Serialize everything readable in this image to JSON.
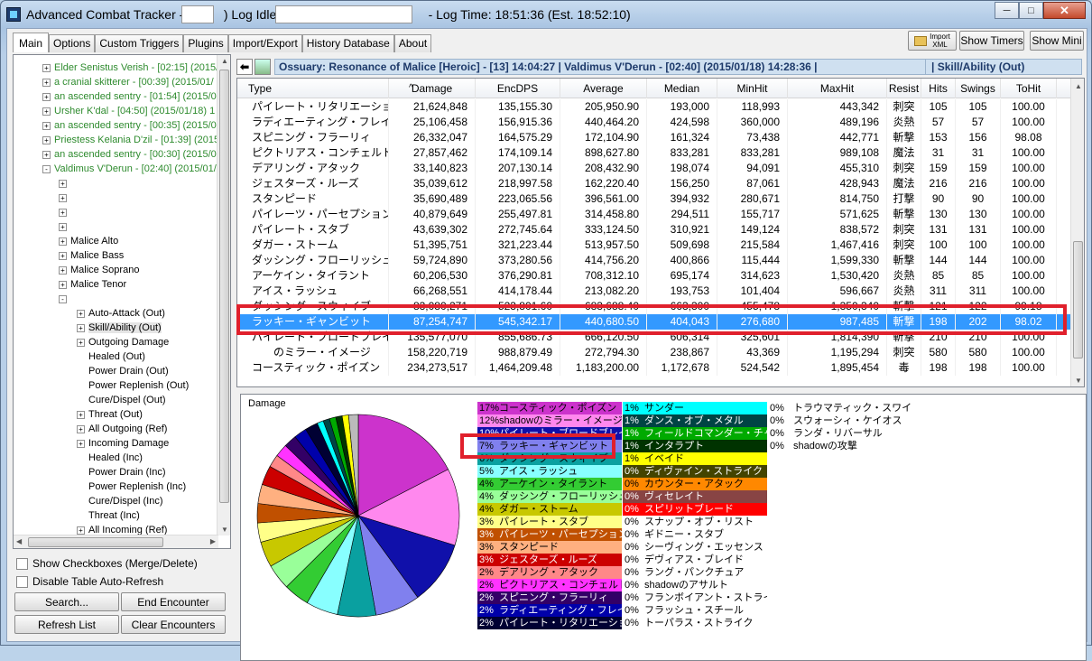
{
  "window": {
    "title_prefix": "Advanced Combat Tracker - (",
    "title_mid": ") Log Idle - ",
    "title_suffix": " - Log Time: 18:51:36 (Est. 18:52:10)",
    "minimize": "─",
    "maximize": "□",
    "close": "✕"
  },
  "tabs": [
    "Main",
    "Options",
    "Custom Triggers",
    "Plugins",
    "Import/Export",
    "History Database",
    "About"
  ],
  "toolbar": {
    "import_label_1": "Import",
    "import_label_2": "XML",
    "show_timers": "Show Timers",
    "show_mini": "Show Mini"
  },
  "tree": {
    "encounters": [
      "Elder Senistus Verish - [02:15] (2015/",
      "a cranial skitterer - [00:39] (2015/01/",
      "an ascended sentry - [01:54] (2015/0",
      "Ursher K'dal - [04:50] (2015/01/18) 1",
      "an ascended sentry - [00:35] (2015/0",
      "Priestess Kelania D'zil - [01:39] (2015/",
      "an ascended sentry - [00:30] (2015/0",
      "Valdimus V'Derun - [02:40] (2015/01/"
    ],
    "combatants": [
      "Malice Alto",
      "Malice Bass",
      "Malice Soprano",
      "Malice Tenor"
    ],
    "views": [
      "Auto-Attack (Out)",
      "Skill/Ability (Out)",
      "Outgoing Damage",
      "Healed (Out)",
      "Power Drain (Out)",
      "Power Replenish (Out)",
      "Cure/Dispel (Out)",
      "Threat (Out)",
      "All Outgoing (Ref)",
      "Incoming Damage",
      "Healed (Inc)",
      "Power Drain (Inc)",
      "Power Replenish (Inc)",
      "Cure/Dispel (Inc)",
      "Threat (Inc)",
      "All Incoming (Ref)"
    ]
  },
  "options": {
    "show_checkboxes": "Show Checkboxes (Merge/Delete)",
    "disable_refresh": "Disable Table Auto-Refresh"
  },
  "buttons": {
    "search": "Search...",
    "end_encounter": "End Encounter",
    "refresh_list": "Refresh List",
    "clear_encounters": "Clear Encounters"
  },
  "encounter_header": {
    "title": "Ossuary: Resonance of Malice [Heroic] - [13] 14:04:27  |  Valdimus V'Derun - [02:40] (2015/01/18) 14:28:36  |",
    "view": "|  Skill/Ability (Out)"
  },
  "table": {
    "columns": [
      "Type",
      "Damage",
      "EncDPS",
      "Average",
      "Median",
      "MinHit",
      "MaxHit",
      "Resist",
      "Hits",
      "Swings",
      "ToHit"
    ],
    "sort_indicator": "^",
    "rows": [
      [
        "パイレート・リタリエーション",
        "21,624,848",
        "135,155.30",
        "205,950.90",
        "193,000",
        "118,993",
        "443,342",
        "刺突",
        "105",
        "105",
        "100.00"
      ],
      [
        "ラディエーティング・フレイム III",
        "25,106,458",
        "156,915.36",
        "440,464.20",
        "424,598",
        "360,000",
        "489,196",
        "炎熱",
        "57",
        "57",
        "100.00"
      ],
      [
        "スピニング・フラーリィ",
        "26,332,047",
        "164,575.29",
        "172,104.90",
        "161,324",
        "73,438",
        "442,771",
        "斬撃",
        "153",
        "156",
        "98.08"
      ],
      [
        "ピクトリアス・コンチェルト",
        "27,857,462",
        "174,109.14",
        "898,627.80",
        "833,281",
        "833,281",
        "989,108",
        "魔法",
        "31",
        "31",
        "100.00"
      ],
      [
        "デアリング・アタック",
        "33,140,823",
        "207,130.14",
        "208,432.90",
        "198,074",
        "94,091",
        "455,310",
        "刺突",
        "159",
        "159",
        "100.00"
      ],
      [
        "ジェスターズ・ルーズ",
        "35,039,612",
        "218,997.58",
        "162,220.40",
        "156,250",
        "87,061",
        "428,943",
        "魔法",
        "216",
        "216",
        "100.00"
      ],
      [
        "スタンピード",
        "35,690,489",
        "223,065.56",
        "396,561.00",
        "394,932",
        "280,671",
        "814,750",
        "打撃",
        "90",
        "90",
        "100.00"
      ],
      [
        "パイレーツ・パーセプション",
        "40,879,649",
        "255,497.81",
        "314,458.80",
        "294,511",
        "155,717",
        "571,625",
        "斬撃",
        "130",
        "130",
        "100.00"
      ],
      [
        "パイレート・スタブ",
        "43,639,302",
        "272,745.64",
        "333,124.50",
        "310,921",
        "149,124",
        "838,572",
        "刺突",
        "131",
        "131",
        "100.00"
      ],
      [
        "ダガー・ストーム",
        "51,395,751",
        "321,223.44",
        "513,957.50",
        "509,698",
        "215,584",
        "1,467,416",
        "刺突",
        "100",
        "100",
        "100.00"
      ],
      [
        "ダッシング・フローリッシュ",
        "59,724,890",
        "373,280.56",
        "414,756.20",
        "400,866",
        "115,444",
        "1,599,330",
        "斬撃",
        "144",
        "144",
        "100.00"
      ],
      [
        "アーケイン・タイラント",
        "60,206,530",
        "376,290.81",
        "708,312.10",
        "695,174",
        "314,623",
        "1,530,420",
        "炎熱",
        "85",
        "85",
        "100.00"
      ],
      [
        "アイス・ラッシュ",
        "66,268,551",
        "414,178.44",
        "213,082.20",
        "193,753",
        "101,404",
        "596,667",
        "炎熱",
        "311",
        "311",
        "100.00"
      ],
      [
        "ダッシング・スウィイブ",
        "83,080,271",
        "523,801.60",
        "683,688.40",
        "663,300",
        "455,478",
        "1,350,340",
        "斬撃",
        "121",
        "122",
        "99.18"
      ],
      [
        "ラッキー・ギャンビット",
        "87,254,747",
        "545,342.17",
        "440,680.50",
        "404,043",
        "276,680",
        "987,485",
        "斬撃",
        "198",
        "202",
        "98.02"
      ],
      [
        "パイレート・ブロードブレイド",
        "135,577,070",
        "855,686.73",
        "666,120.50",
        "606,314",
        "325,601",
        "1,814,390",
        "斬撃",
        "210",
        "210",
        "100.00"
      ],
      [
        "　　のミラー・イメージ",
        "158,220,719",
        "988,879.49",
        "272,794.30",
        "238,867",
        "43,369",
        "1,195,294",
        "刺突",
        "580",
        "580",
        "100.00"
      ],
      [
        "コースティック・ポイズン",
        "234,273,517",
        "1,464,209.48",
        "1,183,200.00",
        "1,172,678",
        "524,542",
        "1,895,454",
        "毒",
        "198",
        "198",
        "100.00"
      ]
    ],
    "selected_index": 14
  },
  "chart_data": {
    "type": "pie",
    "title": "Damage",
    "slices": [
      {
        "label": "コースティック・ポイズン",
        "pct": 17,
        "color": "#cc33cc"
      },
      {
        "label": "shadowのミラー・イメージ",
        "pct": 12,
        "color": "#ff88ee"
      },
      {
        "label": "パイレート・ブロードブレイド",
        "pct": 10,
        "color": "#1010aa"
      },
      {
        "label": "ラッキー・ギャンビット",
        "pct": 7,
        "color": "#8080ee"
      },
      {
        "label": "ダッシング・スウィイブ",
        "pct": 6,
        "color": "#0aa0a0"
      },
      {
        "label": "アイス・ラッシュ",
        "pct": 5,
        "color": "#88ffff"
      },
      {
        "label": "アーケイン・タイラント",
        "pct": 4,
        "color": "#33cc33"
      },
      {
        "label": "ダッシング・フローリッシュ",
        "pct": 4,
        "color": "#99ff99"
      },
      {
        "label": "ダガー・ストーム",
        "pct": 4,
        "color": "#c8c800"
      },
      {
        "label": "パイレート・スタブ",
        "pct": 3,
        "color": "#ffff88"
      },
      {
        "label": "パイレーツ・パーセプション",
        "pct": 3,
        "color": "#c05000"
      },
      {
        "label": "スタンピード",
        "pct": 3,
        "color": "#ffb080"
      },
      {
        "label": "ジェスターズ・ルーズ",
        "pct": 3,
        "color": "#cc0000"
      },
      {
        "label": "デアリング・アタック",
        "pct": 2,
        "color": "#ff8888"
      },
      {
        "label": "ピクトリアス・コンチェルト",
        "pct": 2,
        "color": "#ff33ff"
      },
      {
        "label": "スピニング・フラーリィ",
        "pct": 2,
        "color": "#330066"
      },
      {
        "label": "ラディエーティング・フレイム III",
        "pct": 2,
        "color": "#0000aa"
      },
      {
        "label": "パイレート・リタリエーション",
        "pct": 2,
        "color": "#000033"
      },
      {
        "label": "サンダー",
        "pct": 1,
        "color": "#00ffff"
      },
      {
        "label": "ダンス・オブ・メタル",
        "pct": 1,
        "color": "#004444"
      },
      {
        "label": "フィールドコマンダー・チャージ",
        "pct": 1,
        "color": "#00aa00"
      },
      {
        "label": "インタラプト",
        "pct": 1,
        "color": "#003300"
      },
      {
        "label": "イベイド",
        "pct": 1,
        "color": "#ffff00"
      }
    ],
    "legend_col2": [
      {
        "pct": "1%",
        "label": "サンダー",
        "color": "#00ffff"
      },
      {
        "pct": "1%",
        "label": "ダンス・オブ・メタル",
        "color": "#004444"
      },
      {
        "pct": "1%",
        "label": "フィールドコマンダー・チャージ",
        "color": "#00aa00"
      },
      {
        "pct": "1%",
        "label": "インタラプト",
        "color": "#003300"
      },
      {
        "pct": "1%",
        "label": "イベイド",
        "color": "#ffff00"
      },
      {
        "pct": "0%",
        "label": "ディヴァイン・ストライク",
        "color": "#444400"
      },
      {
        "pct": "0%",
        "label": "カウンター・アタック",
        "color": "#ff8800"
      },
      {
        "pct": "0%",
        "label": "ヴィセレイト",
        "color": "#884444"
      },
      {
        "pct": "0%",
        "label": "スピリットブレード",
        "color": "#ff0000"
      },
      {
        "pct": "0%",
        "label": "スナップ・オブ・リスト",
        "color": "#ffffff"
      },
      {
        "pct": "0%",
        "label": "ギドニー・スタブ",
        "color": "#ffffff"
      },
      {
        "pct": "0%",
        "label": "シーヴィング・エッセンス",
        "color": "#ffffff"
      },
      {
        "pct": "0%",
        "label": "デヴィアス・ブレイド",
        "color": "#ffffff"
      },
      {
        "pct": "0%",
        "label": "ラング・パンクチュア",
        "color": "#ffffff"
      },
      {
        "pct": "0%",
        "label": "shadowのアサルト",
        "color": "#ffffff"
      },
      {
        "pct": "0%",
        "label": "フランボイアント・ストライク",
        "color": "#ffffff"
      },
      {
        "pct": "0%",
        "label": "フラッシュ・スチール",
        "color": "#ffffff"
      },
      {
        "pct": "0%",
        "label": "トーパラス・ストライク",
        "color": "#ffffff"
      }
    ],
    "legend_col3": [
      {
        "pct": "0%",
        "label": "トラウマティック・スワイプ"
      },
      {
        "pct": "0%",
        "label": "スウォーシィ・ケイオス"
      },
      {
        "pct": "0%",
        "label": "ランダ・リバーサル"
      },
      {
        "pct": "0%",
        "label": "shadowの攻撃"
      }
    ]
  }
}
